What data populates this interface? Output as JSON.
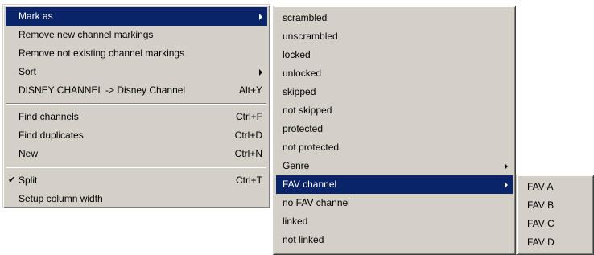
{
  "main_menu": {
    "items": [
      {
        "label": "Mark as",
        "shortcut": "",
        "submenu": true,
        "highlighted": true
      },
      {
        "label": "Remove new channel markings",
        "shortcut": ""
      },
      {
        "label": "Remove not existing channel markings",
        "shortcut": ""
      },
      {
        "label": "Sort",
        "shortcut": "",
        "submenu": true
      },
      {
        "label": "DISNEY CHANNEL -> Disney Channel",
        "shortcut": "Alt+Y"
      },
      {
        "label": "Find channels",
        "shortcut": "Ctrl+F"
      },
      {
        "label": "Find duplicates",
        "shortcut": "Ctrl+D"
      },
      {
        "label": "New",
        "shortcut": "Ctrl+N"
      },
      {
        "label": "Split",
        "shortcut": "Ctrl+T",
        "checked": true,
        "check_mark": "✔"
      },
      {
        "label": "Setup column width",
        "shortcut": ""
      }
    ]
  },
  "mark_as_menu": {
    "items": [
      {
        "label": "scrambled"
      },
      {
        "label": "unscrambled"
      },
      {
        "label": "locked"
      },
      {
        "label": "unlocked"
      },
      {
        "label": "skipped"
      },
      {
        "label": "not skipped"
      },
      {
        "label": "protected"
      },
      {
        "label": "not protected"
      },
      {
        "label": "Genre",
        "submenu": true
      },
      {
        "label": "FAV channel",
        "submenu": true,
        "highlighted": true
      },
      {
        "label": "no FAV channel"
      },
      {
        "label": "linked"
      },
      {
        "label": "not linked"
      }
    ]
  },
  "fav_menu": {
    "items": [
      {
        "label": "FAV A"
      },
      {
        "label": "FAV B"
      },
      {
        "label": "FAV C"
      },
      {
        "label": "FAV D"
      }
    ]
  },
  "colors": {
    "menu_background": "#d4d0c8",
    "highlight_background": "#0a246a",
    "highlight_text": "#ffffff"
  },
  "icons": {
    "submenu_arrow": "submenu-arrow-icon",
    "check": "check-icon"
  }
}
